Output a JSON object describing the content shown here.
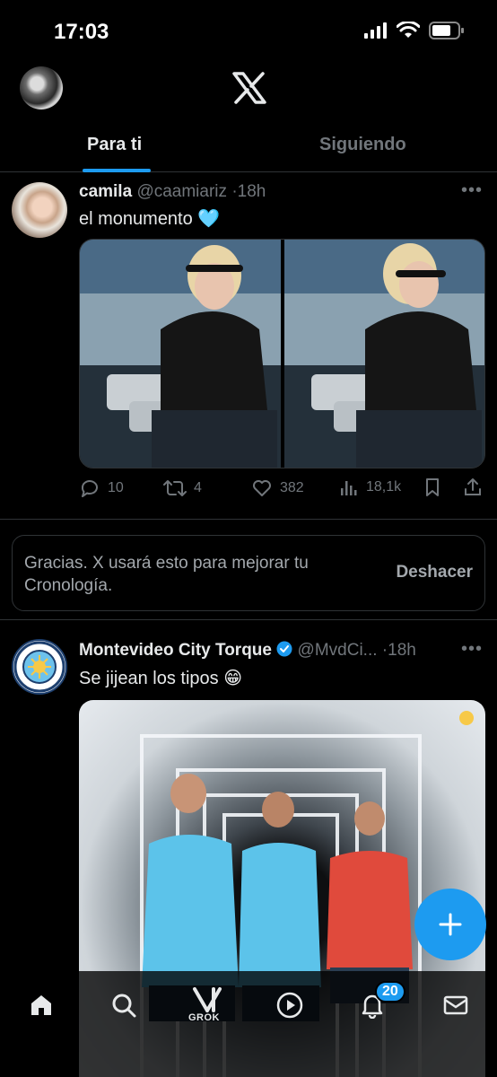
{
  "status_bar": {
    "time": "17:03"
  },
  "header": {
    "tabs": [
      {
        "label": "Para ti"
      },
      {
        "label": "Siguiendo"
      }
    ]
  },
  "tweets": [
    {
      "name": "camila",
      "handle": "@caamiariz",
      "time": "18h",
      "text": "el monumento 🩵",
      "replies": "10",
      "retweets": "4",
      "likes": "382",
      "views": "18,1k"
    },
    {
      "name": "Montevideo City Torque",
      "handle": "@MvdCi...",
      "time": "18h",
      "text": "Se jijean los tipos 😁",
      "verified": true
    }
  ],
  "feedback": {
    "message": "Gracias. X usará esto para mejorar tu Cronología.",
    "undo_label": "Deshacer"
  },
  "bottom_nav": {
    "grok_label": "GROK",
    "notifications_badge": "20"
  },
  "colors": {
    "accent": "#1d9bf0",
    "background": "#000000",
    "muted": "#71767b"
  }
}
